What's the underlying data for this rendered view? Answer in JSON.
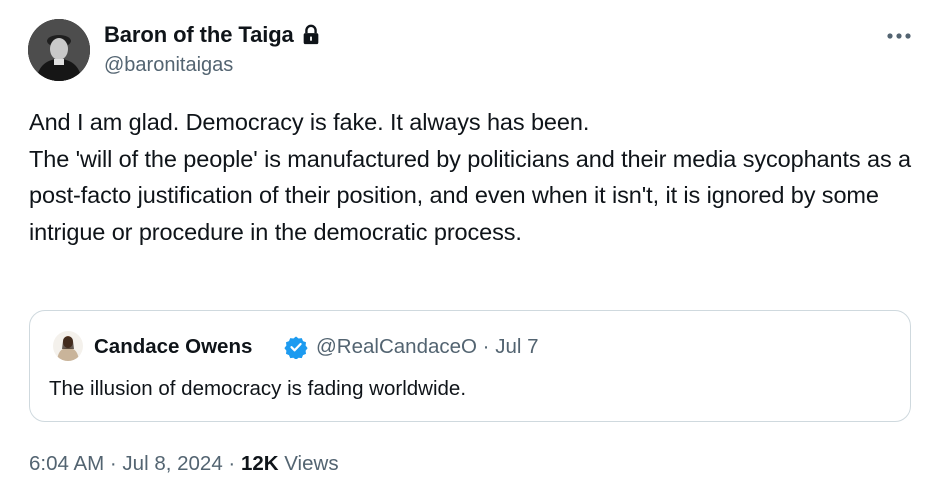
{
  "author": {
    "display_name": "Baron of the Taiga",
    "handle": "@baronitaigas",
    "protected_icon": "lock-icon",
    "avatar_icon": "profile-photo"
  },
  "menu": {
    "more_icon": "more-horizontal-icon"
  },
  "tweet": {
    "paragraphs": [
      "And I am glad. Democracy is fake. It always has been.",
      "The 'will of the people' is manufactured by politicians and their media sycophants as a post-facto justification of their position, and even when it isn't, it is ignored by some intrigue or procedure in the democratic process."
    ]
  },
  "quote": {
    "name": "Candace Owens",
    "verified_icon": "verified-badge-icon",
    "handle_date": "@RealCandaceO · Jul 7",
    "text": "The illusion of democracy is fading worldwide."
  },
  "meta": {
    "time_date": "6:04 AM · Jul 8, 2024 · ",
    "views_count": "12K",
    "views_label": " Views"
  },
  "colors": {
    "text": "#0f1419",
    "secondary": "#536471",
    "border": "#cfd9de",
    "verified": "#1d9bf0"
  }
}
